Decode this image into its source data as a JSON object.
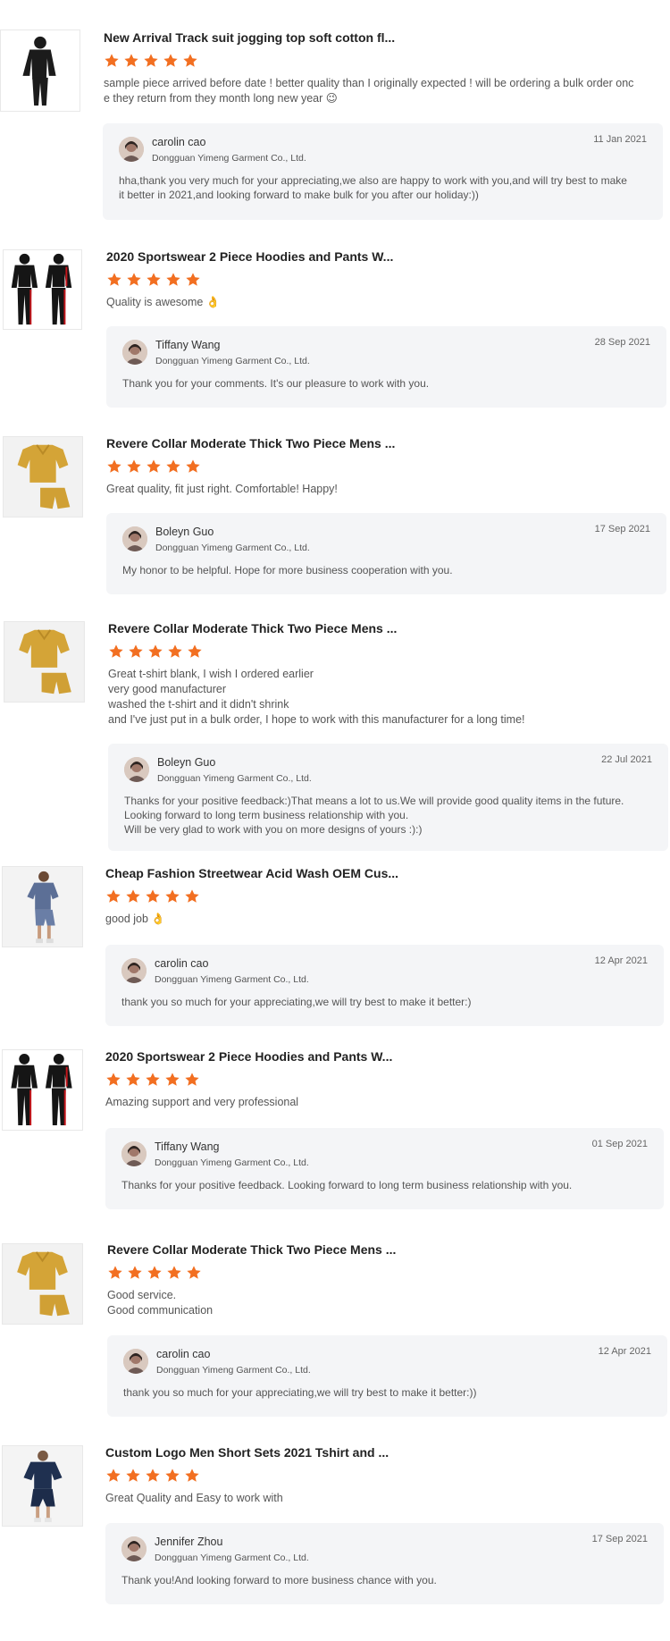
{
  "colors": {
    "star": "#f26f21",
    "reply_bg": "#f4f5f7"
  },
  "reviews": [
    {
      "product_title": "New Arrival Track suit jogging top soft cotton fl...",
      "rating": 5,
      "text": "sample piece arrived before date ! better quality than I originally expected ! will be ordering a bulk order onc\ne they return from they month long new year 😉",
      "reply": {
        "name": "carolin cao",
        "company": "Dongguan Yimeng Garment Co., Ltd.",
        "date": "11 Jan 2021",
        "message": "hha,thank you very much for your appreciating,we also are happy to work with you,and will try best to make\nit better in 2021,and looking forward to make bulk for you after our holiday:))"
      }
    },
    {
      "product_title": "2020 Sportswear 2 Piece Hoodies and Pants W...",
      "rating": 5,
      "text": "Quality is awesome 👌",
      "reply": {
        "name": "Tiffany Wang",
        "company": "Dongguan Yimeng Garment Co., Ltd.",
        "date": "28 Sep 2021",
        "message": "Thank you for your comments. It's our pleasure to work with you."
      }
    },
    {
      "product_title": "Revere Collar Moderate Thick Two Piece Mens ...",
      "rating": 5,
      "text": "Great quality, fit just right. Comfortable! Happy!",
      "reply": {
        "name": "Boleyn Guo",
        "company": "Dongguan Yimeng Garment Co., Ltd.",
        "date": "17 Sep 2021",
        "message": "My honor to be helpful. Hope for more business cooperation with you."
      }
    },
    {
      "product_title": "Revere Collar Moderate Thick Two Piece Mens ...",
      "rating": 5,
      "text": "Great t-shirt blank, I wish I ordered earlier\nvery good manufacturer\nwashed the t-shirt and it didn't shrink\nand I've just put in a bulk order, I hope to work with this manufacturer for a long time!",
      "reply": {
        "name": "Boleyn Guo",
        "company": "Dongguan Yimeng Garment Co., Ltd.",
        "date": "22 Jul 2021",
        "message": "Thanks for your positive feedback:)That means a lot to us.We will provide good quality items in the future.\nLooking forward to long term business relationship with you.\nWill be very glad to work with you on more designs of yours :):)"
      }
    },
    {
      "product_title": "Cheap Fashion Streetwear Acid Wash OEM Cus...",
      "rating": 5,
      "text": "good job 👌",
      "reply": {
        "name": "carolin cao",
        "company": "Dongguan Yimeng Garment Co., Ltd.",
        "date": "12 Apr 2021",
        "message": "thank you so much for your appreciating,we will try best to make it better:)"
      }
    },
    {
      "product_title": "2020 Sportswear 2 Piece Hoodies and Pants W...",
      "rating": 5,
      "text": "Amazing support and very professional",
      "reply": {
        "name": "Tiffany Wang",
        "company": "Dongguan Yimeng Garment Co., Ltd.",
        "date": "01 Sep 2021",
        "message": "Thanks for your positive feedback. Looking forward to long term business relationship with you."
      }
    },
    {
      "product_title": "Revere Collar Moderate Thick Two Piece Mens ...",
      "rating": 5,
      "text": "Good service.\nGood communication",
      "reply": {
        "name": "carolin cao",
        "company": "Dongguan Yimeng Garment Co., Ltd.",
        "date": "12 Apr 2021",
        "message": "thank you so much for your appreciating,we will try best to make it better:))"
      }
    },
    {
      "product_title": "Custom Logo Men Short Sets 2021 Tshirt and ...",
      "rating": 5,
      "text": "Great Quality and Easy to work with",
      "reply": {
        "name": "Jennifer Zhou",
        "company": "Dongguan Yimeng Garment Co., Ltd.",
        "date": "17 Sep 2021",
        "message": "Thank you!And looking forward to more business chance with you."
      }
    }
  ]
}
